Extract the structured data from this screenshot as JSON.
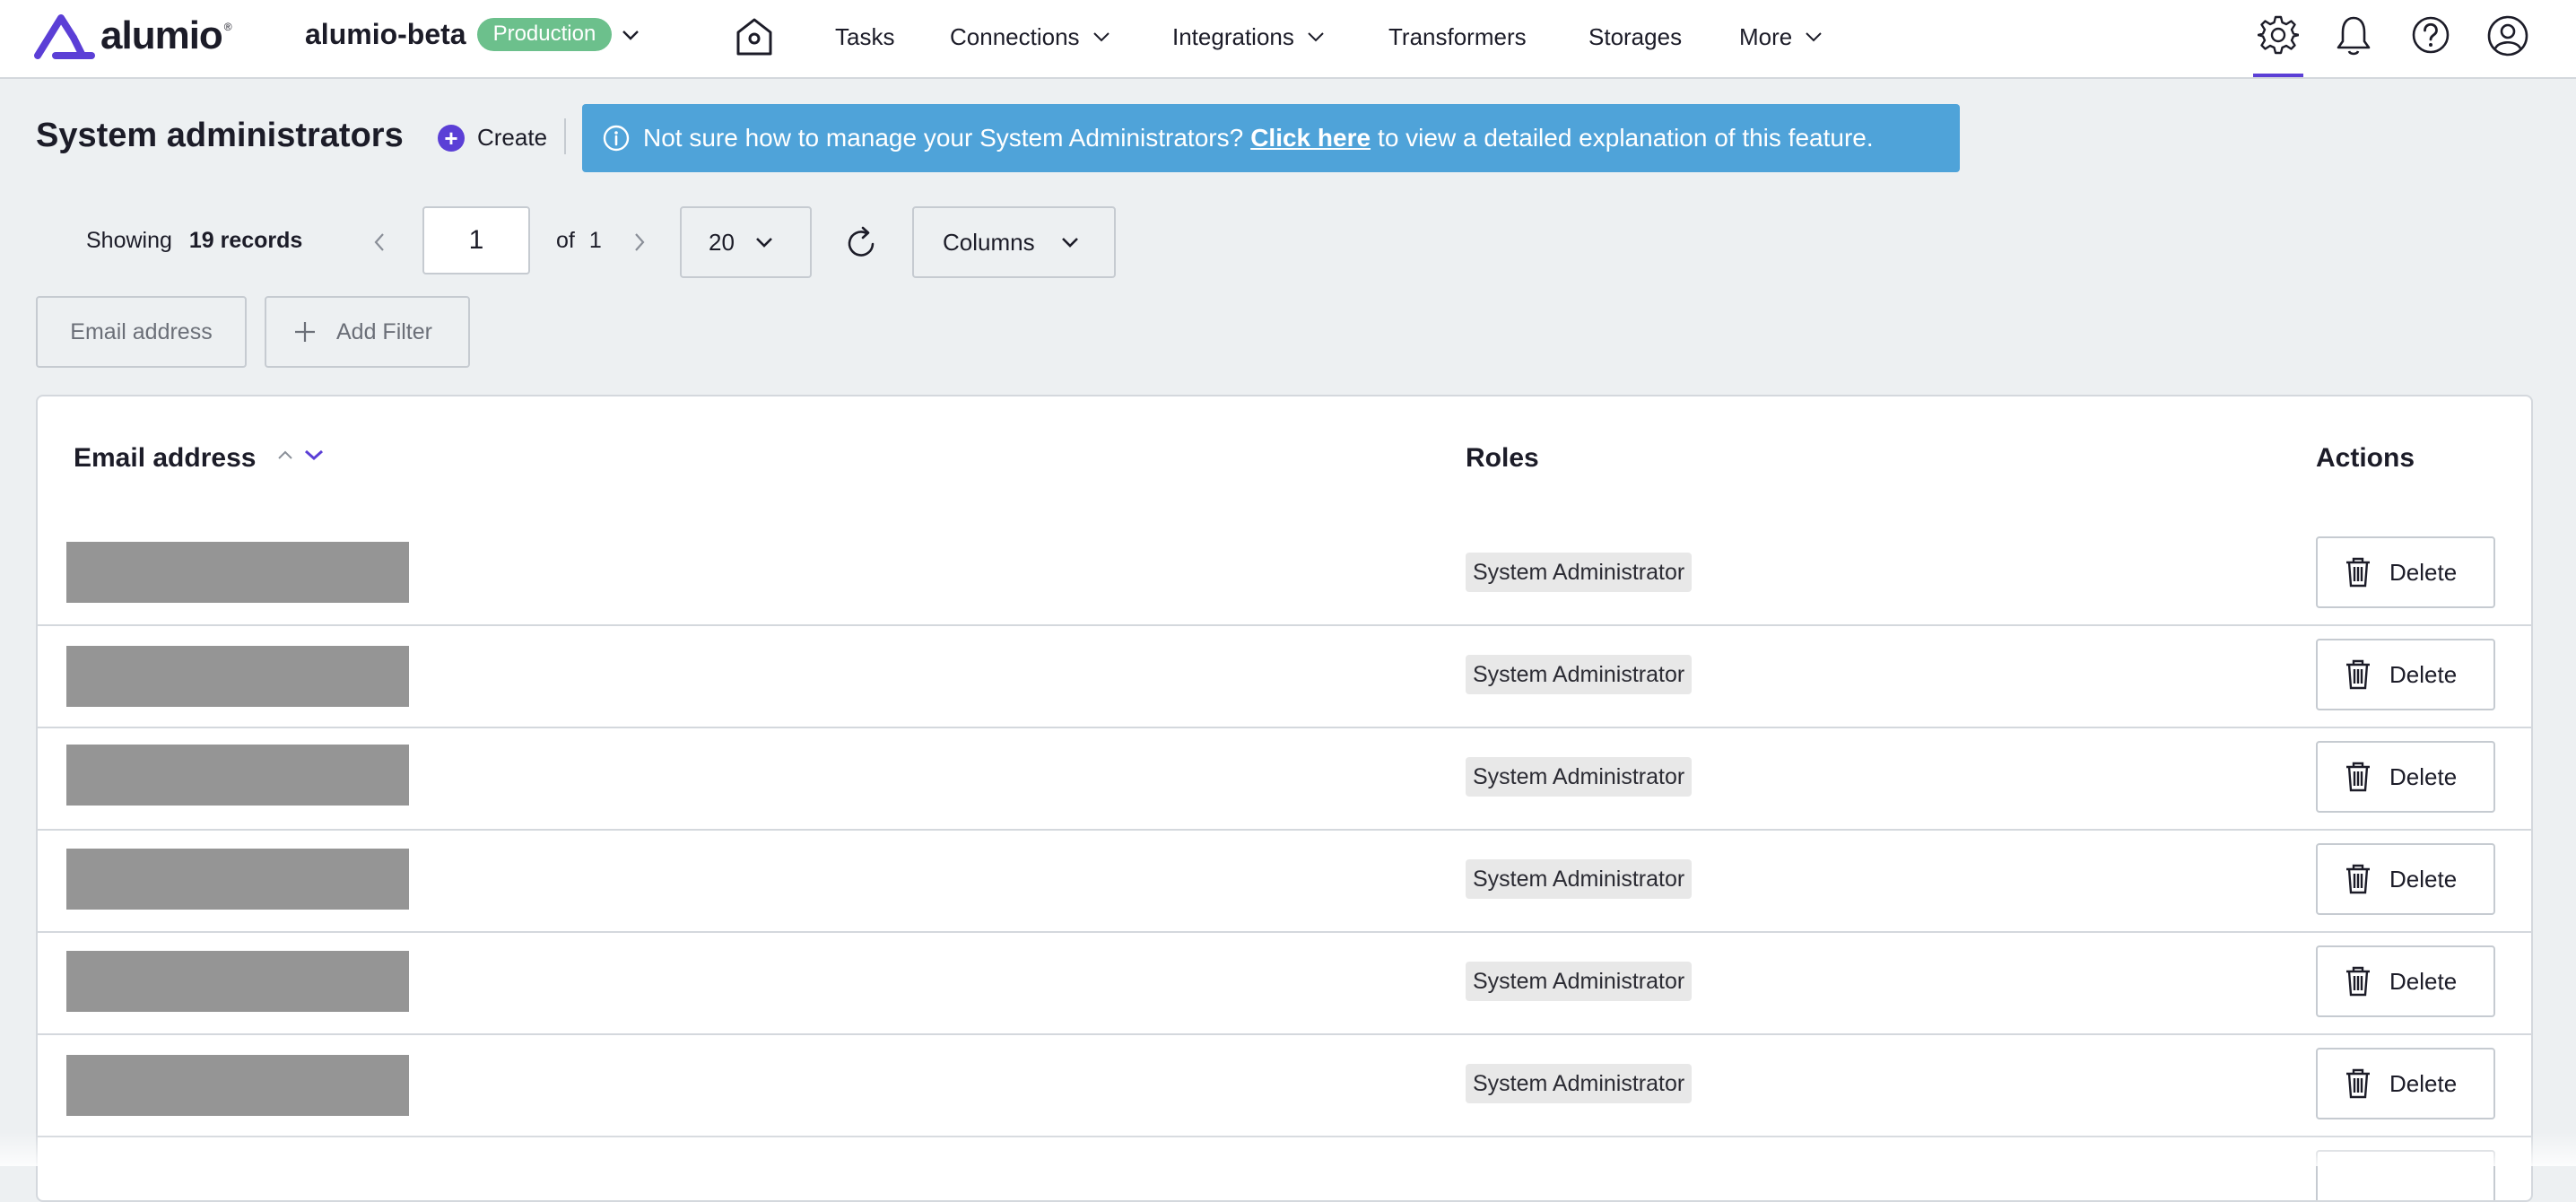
{
  "app": {
    "logo_text": "alumio",
    "environment_name": "alumio-beta",
    "environment_badge": "Production",
    "badge_color": "#6cc08c",
    "accent_color": "#5b3fd6"
  },
  "nav": {
    "items": [
      {
        "label": "Tasks"
      },
      {
        "label": "Connections"
      },
      {
        "label": "Integrations"
      },
      {
        "label": "Transformers"
      },
      {
        "label": "Storages"
      },
      {
        "label": "More"
      }
    ],
    "icons": [
      "home-icon",
      "settings-icon",
      "bell-icon",
      "help-icon",
      "user-icon"
    ]
  },
  "page": {
    "title": "System administrators",
    "create_label": "Create",
    "info": {
      "icon": "info-icon",
      "before": "Not sure how to manage your System Administrators?",
      "link": "Click here",
      "after": "to view a detailed explanation of this feature.",
      "color": "#4fa3d9"
    }
  },
  "pager": {
    "showing_label": "Showing",
    "records_label": "19 records",
    "page": "1",
    "of_label": "of",
    "total_pages": "1",
    "per_page": "20",
    "columns_label": "Columns"
  },
  "filters": {
    "email_label": "Email address",
    "add_filter_label": "Add Filter"
  },
  "table": {
    "headers": {
      "email": "Email address",
      "roles": "Roles",
      "actions": "Actions"
    },
    "rows": [
      {
        "role": "System Administrator",
        "action": "Delete"
      },
      {
        "role": "System Administrator",
        "action": "Delete"
      },
      {
        "role": "System Administrator",
        "action": "Delete"
      },
      {
        "role": "System Administrator",
        "action": "Delete"
      },
      {
        "role": "System Administrator",
        "action": "Delete"
      },
      {
        "role": "System Administrator",
        "action": "Delete"
      },
      {
        "role": "",
        "action": ""
      }
    ]
  }
}
